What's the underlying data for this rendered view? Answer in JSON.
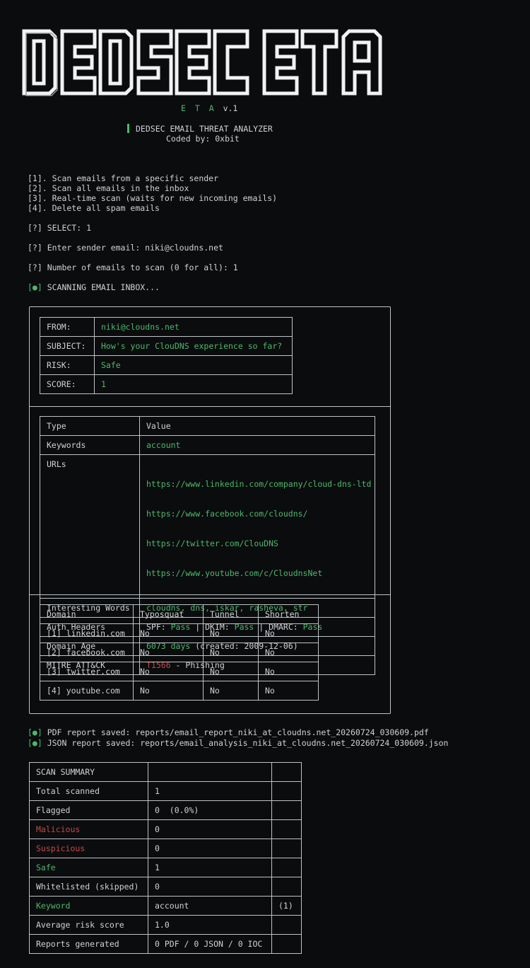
{
  "banner": {
    "title": "DEDSEC ETA"
  },
  "version": {
    "eta": "E T A",
    "ver": "v.1"
  },
  "subtitle": {
    "name": "DEDSEC EMAIL THREAT ANALYZER",
    "coded": "Coded by: 0xbit"
  },
  "menu": [
    "[1]. Scan emails from a specific sender",
    "[2]. Scan all emails in the inbox",
    "[3]. Real-time scan (waits for new incoming emails)",
    "[4]. Delete all spam emails"
  ],
  "prompts": {
    "select": "[?] SELECT: 1",
    "sender": "[?] Enter sender email: niki@cloudns.net",
    "count": "[?] Number of emails to scan (0 for all): 1",
    "scanning_mark": "[●]",
    "scanning": " SCANNING EMAIL INBOX..."
  },
  "email": {
    "from_label": "FROM:",
    "from": "niki@cloudns.net",
    "subject_label": "SUBJECT:",
    "subject": "How's your ClouDNS experience so far?",
    "risk_label": "RISK:",
    "risk": "Safe",
    "score_label": "SCORE:",
    "score": "1"
  },
  "details": {
    "h_type": "Type",
    "h_value": "Value",
    "keywords_label": "Keywords",
    "keywords": "account",
    "urls_label": "URLs",
    "urls": [
      "https://www.linkedin.com/company/cloud-dns-ltd",
      "https://www.facebook.com/cloudns/",
      "https://twitter.com/ClouDNS",
      "https://www.youtube.com/c/CloudnsNet"
    ],
    "words_label": "Interesting Words",
    "words": "cloudns, dns, iskar, rasheva, str",
    "auth_label": "Auth Headers",
    "spf_k": "SPF: ",
    "spf_v": "Pass",
    "sep1": " | ",
    "dkim_k": "DKIM: ",
    "dkim_v": "Pass",
    "sep2": " | ",
    "dmarc_k": "DMARC: ",
    "dmarc_v": "Pass",
    "age_label": "Domain Age",
    "age_days": "6073 days",
    "age_created": " (created: 2009-12-06)",
    "mitre_label": "MITRE ATT&CK",
    "mitre_id": "T1566",
    "mitre_name": " - Phishing"
  },
  "domains": {
    "headers": [
      "Domain",
      "Typosquat",
      "Tunnel",
      "Shorten"
    ],
    "rows": [
      [
        "[1] linkedin.com",
        "No",
        "No",
        "No"
      ],
      [
        "[2] facebook.com",
        "No",
        "No",
        "No"
      ],
      [
        "[3] twitter.com",
        "No",
        "No",
        "No"
      ],
      [
        "[4] youtube.com",
        "No",
        "No",
        "No"
      ]
    ]
  },
  "reports": {
    "pdf_mark": "[●]",
    "pdf": " PDF report saved: reports/email_report_niki_at_cloudns.net_20260724_030609.pdf",
    "json_mark": "[●]",
    "json": " JSON report saved: reports/email_analysis_niki_at_cloudns.net_20260724_030609.json"
  },
  "summary": {
    "title": "SCAN SUMMARY",
    "rows": [
      {
        "label": "Total scanned",
        "value": "1",
        "extra": ""
      },
      {
        "label": "Flagged",
        "value": "0  (0.0%)",
        "extra": ""
      },
      {
        "label": "Malicious",
        "value": "0",
        "extra": ""
      },
      {
        "label": "Suspicious",
        "value": "0",
        "extra": ""
      },
      {
        "label": "Safe",
        "value": "1",
        "extra": ""
      },
      {
        "label": "Whitelisted (skipped)",
        "value": "0",
        "extra": ""
      },
      {
        "label": "Keyword",
        "value": "account",
        "extra": "(1)"
      },
      {
        "label": "Average risk score",
        "value": "1.0",
        "extra": ""
      },
      {
        "label": "Reports generated",
        "value": "0 PDF / 0 JSON / 0 IOC",
        "extra": ""
      }
    ]
  },
  "colors": {
    "accent": "#4cb86c",
    "danger": "#c24a4a",
    "text": "#cfd2d4",
    "background": "#0b0c0e"
  }
}
